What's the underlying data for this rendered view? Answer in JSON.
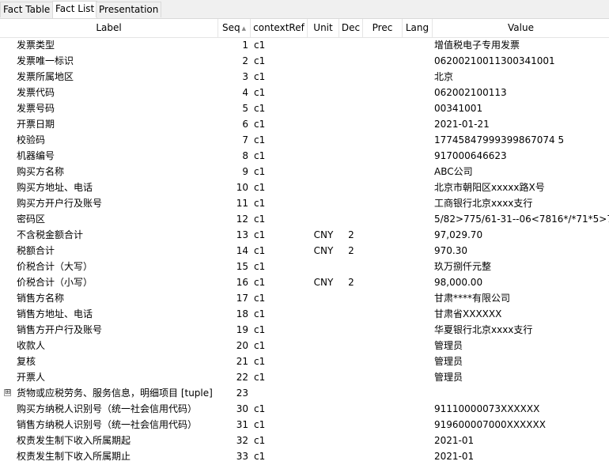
{
  "tabs": [
    {
      "label": "Fact Table",
      "active": false
    },
    {
      "label": "Fact List",
      "active": true
    },
    {
      "label": "Presentation",
      "active": false
    }
  ],
  "columns": {
    "label": "Label",
    "seq": "Seq",
    "contextRef": "contextRef",
    "unit": "Unit",
    "dec": "Dec",
    "prec": "Prec",
    "lang": "Lang",
    "value": "Value"
  },
  "rows": [
    {
      "label": "发票类型",
      "seq": "1",
      "ctx": "c1",
      "unit": "",
      "dec": "",
      "value": "增值税电子专用发票"
    },
    {
      "label": "发票唯一标识",
      "seq": "2",
      "ctx": "c1",
      "unit": "",
      "dec": "",
      "value": "06200210011300341001"
    },
    {
      "label": "发票所属地区",
      "seq": "3",
      "ctx": "c1",
      "unit": "",
      "dec": "",
      "value": "北京"
    },
    {
      "label": "发票代码",
      "seq": "4",
      "ctx": "c1",
      "unit": "",
      "dec": "",
      "value": "062002100113"
    },
    {
      "label": "发票号码",
      "seq": "5",
      "ctx": "c1",
      "unit": "",
      "dec": "",
      "value": "00341001"
    },
    {
      "label": "开票日期",
      "seq": "6",
      "ctx": "c1",
      "unit": "",
      "dec": "",
      "value": "2021-01-21"
    },
    {
      "label": "校验码",
      "seq": "7",
      "ctx": "c1",
      "unit": "",
      "dec": "",
      "value": "17745847999399867074 5"
    },
    {
      "label": "机器编号",
      "seq": "8",
      "ctx": "c1",
      "unit": "",
      "dec": "",
      "value": "917000646623"
    },
    {
      "label": "购买方名称",
      "seq": "9",
      "ctx": "c1",
      "unit": "",
      "dec": "",
      "value": "ABC公司"
    },
    {
      "label": "购买方地址、电话",
      "seq": "10",
      "ctx": "c1",
      "unit": "",
      "dec": "",
      "value": "北京市朝阳区xxxxx路X号"
    },
    {
      "label": "购买方开户行及账号",
      "seq": "11",
      "ctx": "c1",
      "unit": "",
      "dec": "",
      "value": "工商银行北京xxxx支行"
    },
    {
      "label": "密码区",
      "seq": "12",
      "ctx": "c1",
      "unit": "",
      "dec": "",
      "value": "5/82>775/61-31--06<7816*/*71*5>7>"
    },
    {
      "label": "不含税金额合计",
      "seq": "13",
      "ctx": "c1",
      "unit": "CNY",
      "dec": "2",
      "value": "97,029.70"
    },
    {
      "label": "税额合计",
      "seq": "14",
      "ctx": "c1",
      "unit": "CNY",
      "dec": "2",
      "value": "970.30"
    },
    {
      "label": "价税合计（大写）",
      "seq": "15",
      "ctx": "c1",
      "unit": "",
      "dec": "",
      "value": "玖万捌仟元整"
    },
    {
      "label": "价税合计（小写）",
      "seq": "16",
      "ctx": "c1",
      "unit": "CNY",
      "dec": "2",
      "value": "98,000.00"
    },
    {
      "label": "销售方名称",
      "seq": "17",
      "ctx": "c1",
      "unit": "",
      "dec": "",
      "value": "甘肃****有限公司"
    },
    {
      "label": "销售方地址、电话",
      "seq": "18",
      "ctx": "c1",
      "unit": "",
      "dec": "",
      "value": "甘肃省XXXXXX"
    },
    {
      "label": "销售方开户行及账号",
      "seq": "19",
      "ctx": "c1",
      "unit": "",
      "dec": "",
      "value": "华夏银行北京xxxx支行"
    },
    {
      "label": "收款人",
      "seq": "20",
      "ctx": "c1",
      "unit": "",
      "dec": "",
      "value": "管理员"
    },
    {
      "label": "复核",
      "seq": "21",
      "ctx": "c1",
      "unit": "",
      "dec": "",
      "value": "管理员"
    },
    {
      "label": "开票人",
      "seq": "22",
      "ctx": "c1",
      "unit": "",
      "dec": "",
      "value": "管理员"
    },
    {
      "label": "货物或应税劳务、服务信息，明细项目 [tuple]",
      "seq": "23",
      "ctx": "",
      "unit": "",
      "dec": "",
      "value": "",
      "expander": "⊞"
    },
    {
      "label": "购买方纳税人识别号（统一社会信用代码）",
      "seq": "30",
      "ctx": "c1",
      "unit": "",
      "dec": "",
      "value": "91110000073XXXXXX"
    },
    {
      "label": "销售方纳税人识别号（统一社会信用代码）",
      "seq": "31",
      "ctx": "c1",
      "unit": "",
      "dec": "",
      "value": "919600007000XXXXXX"
    },
    {
      "label": "权责发生制下收入所属期起",
      "seq": "32",
      "ctx": "c1",
      "unit": "",
      "dec": "",
      "value": "2021-01"
    },
    {
      "label": "权责发生制下收入所属期止",
      "seq": "33",
      "ctx": "c1",
      "unit": "",
      "dec": "",
      "value": "2021-01"
    }
  ]
}
